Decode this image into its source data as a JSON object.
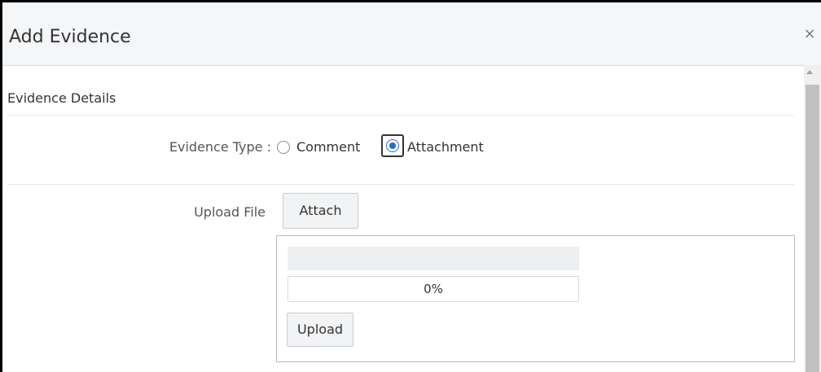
{
  "dialog": {
    "title": "Add Evidence",
    "close_symbol": "×"
  },
  "section": {
    "title": "Evidence Details"
  },
  "evidence_type": {
    "label": "Evidence Type :",
    "options": [
      {
        "label": "Comment",
        "selected": false
      },
      {
        "label": "Attachment",
        "selected": true
      }
    ]
  },
  "upload_file": {
    "label": "Upload File",
    "attach_label": "Attach",
    "progress_fraction": 0,
    "progress_text": "0%",
    "upload_label": "Upload"
  },
  "colors": {
    "accent": "#1b6fd6",
    "header_bg": "#f4f6f8"
  },
  "icons": {
    "close": "close-icon",
    "scroll_up": "scroll-up-arrow-icon"
  }
}
